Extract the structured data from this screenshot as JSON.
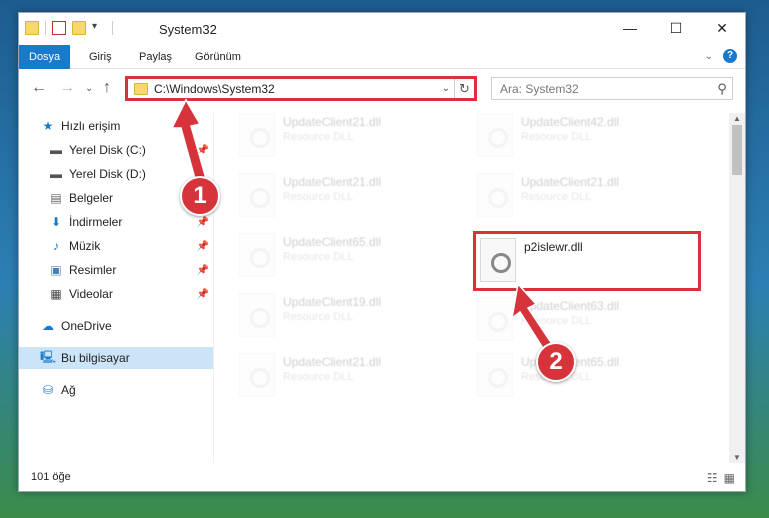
{
  "window": {
    "title": "System32",
    "controls": {
      "minimize": "—",
      "maximize": "☐",
      "close": "✕"
    }
  },
  "ribbon": {
    "tabs": [
      {
        "label": "Dosya"
      },
      {
        "label": "Giriş"
      },
      {
        "label": "Paylaş"
      },
      {
        "label": "Görünüm"
      }
    ],
    "help": "?"
  },
  "address": {
    "path": "C:\\Windows\\System32",
    "search_placeholder": "Ara: System32"
  },
  "sidebar": {
    "items": [
      {
        "label": "Hızlı erişim",
        "icon": "star-icon"
      },
      {
        "label": "Yerel Disk (C:)",
        "icon": "drive-icon"
      },
      {
        "label": "Yerel Disk (D:)",
        "icon": "drive-icon"
      },
      {
        "label": "Belgeler",
        "icon": "documents-icon"
      },
      {
        "label": "İndirmeler",
        "icon": "download-icon"
      },
      {
        "label": "Müzik",
        "icon": "music-icon"
      },
      {
        "label": "Resimler",
        "icon": "pictures-icon"
      },
      {
        "label": "Videolar",
        "icon": "videos-icon"
      },
      {
        "label": "OneDrive",
        "icon": "cloud-icon"
      },
      {
        "label": "Bu bilgisayar",
        "icon": "computer-icon"
      },
      {
        "label": "Ağ",
        "icon": "network-icon"
      }
    ]
  },
  "files": [
    {
      "name": "UpdateClient21.dll",
      "desc": "Resource DLL"
    },
    {
      "name": "UpdateClient42.dll",
      "desc": "Resource DLL"
    },
    {
      "name": "UpdateClient21.dll",
      "desc": "Resource DLL"
    },
    {
      "name": "UpdateClient21.dll",
      "desc": "Resource DLL"
    },
    {
      "name": "UpdateClient65.dll",
      "desc": "Resource DLL"
    },
    {
      "name": "p2islewr.dll",
      "desc": ""
    },
    {
      "name": "UpdateClient19.dll",
      "desc": "Resource DLL"
    },
    {
      "name": "UpdateClient63.dll",
      "desc": "Resource DLL"
    },
    {
      "name": "UpdateClient21.dll",
      "desc": "Resource DLL"
    },
    {
      "name": "UpdateClient65.dll",
      "desc": "Resource DLL"
    }
  ],
  "status": {
    "count": "101 öğe"
  },
  "annotations": {
    "step1": "1",
    "step2": "2"
  },
  "colors": {
    "accent": "#1979ca",
    "annotation": "#d6343a"
  }
}
